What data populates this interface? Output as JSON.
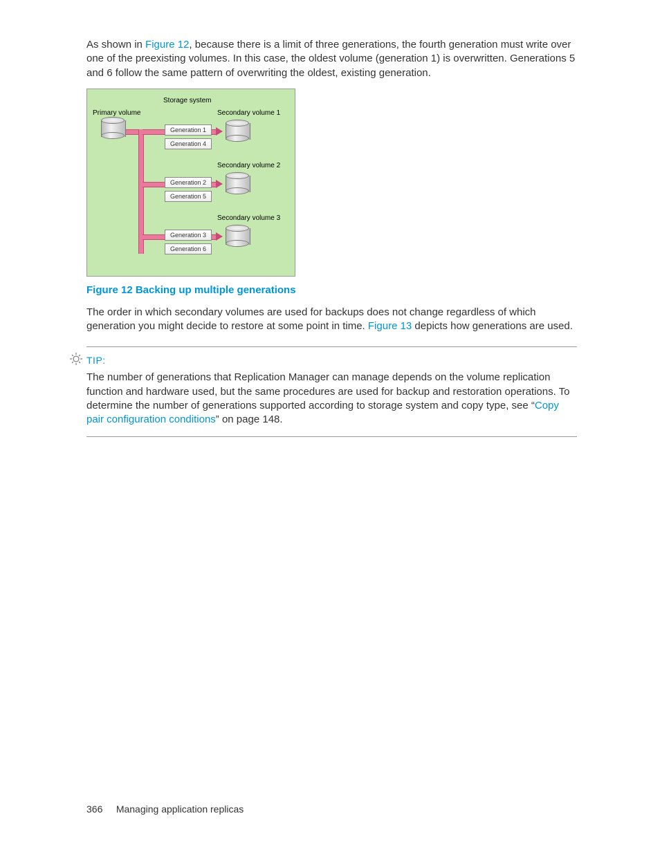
{
  "para1": {
    "pre": "As shown in ",
    "link": "Figure 12",
    "post": ", because there is a limit of three generations, the fourth generation must write over one of the preexisting volumes. In this case, the oldest volume (generation 1) is overwritten. Generations 5 and 6 follow the same pattern of overwriting the oldest, existing generation."
  },
  "figure": {
    "storage_system": "Storage system",
    "primary_volume": "Primary volume",
    "sec1": "Secondary volume 1",
    "sec2": "Secondary volume 2",
    "sec3": "Secondary volume 3",
    "gen1": "Generation 1",
    "gen2": "Generation 2",
    "gen3": "Generation 3",
    "gen4": "Generation 4",
    "gen5": "Generation 5",
    "gen6": "Generation 6"
  },
  "caption": "Figure 12 Backing up multiple generations",
  "para2": {
    "pre": "The order in which secondary volumes are used for backups does not change regardless of which generation you might decide to restore at some point in time. ",
    "link": "Figure 13",
    "post": " depicts how generations are used."
  },
  "tip": {
    "label": "TIP:",
    "body_pre": "The number of generations that Replication Manager can manage depends on the volume replication function and hardware used, but the same procedures are used for backup and restoration operations. To determine the number of generations supported according to storage system and copy type, see “",
    "link": "Copy pair configuration conditions",
    "body_post": "” on page 148."
  },
  "footer": {
    "page": "366",
    "title": "Managing application replicas"
  }
}
